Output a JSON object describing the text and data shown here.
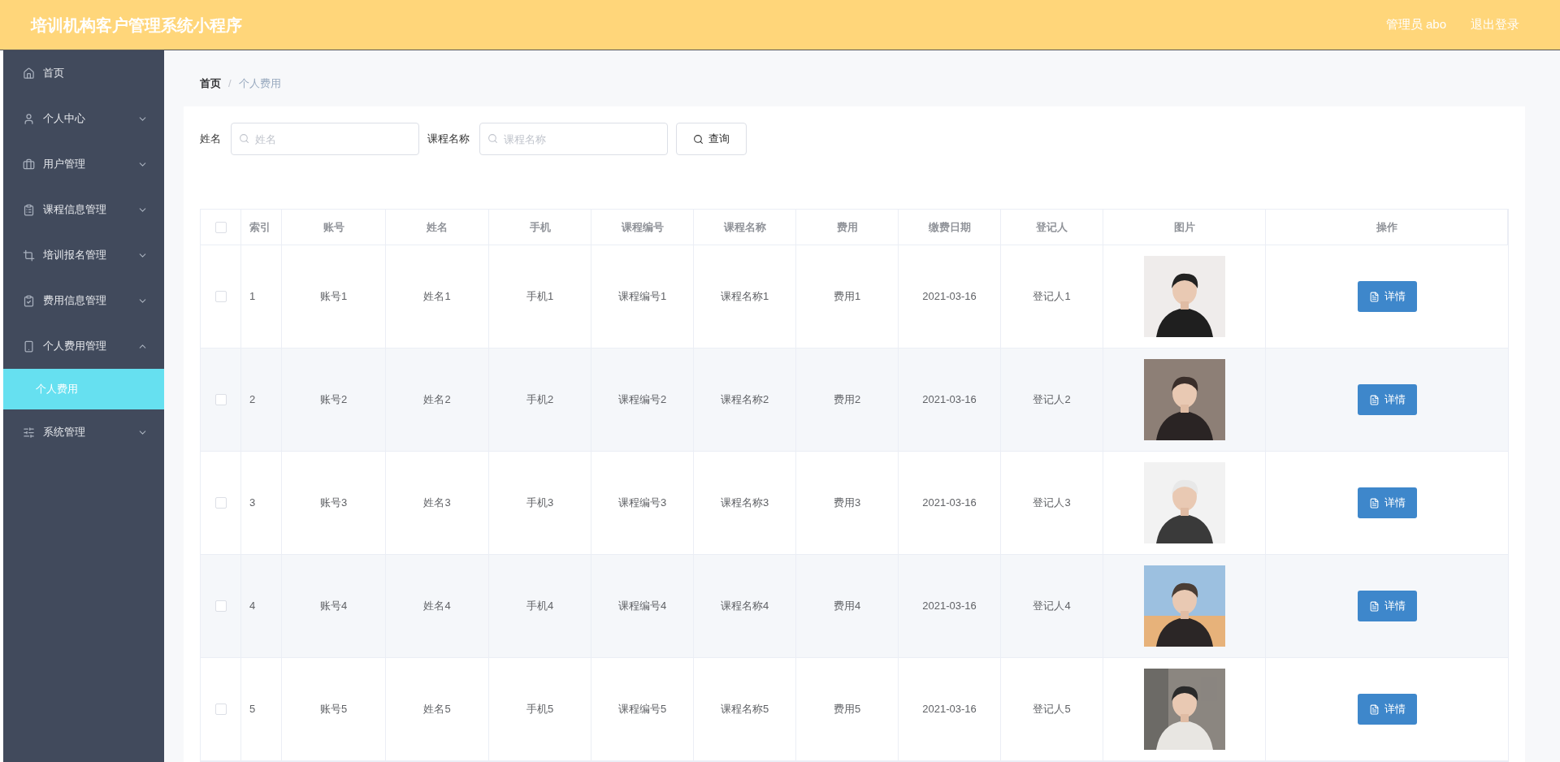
{
  "header": {
    "title": "培训机构客户管理系统小程序",
    "user": "管理员 abo",
    "logout": "退出登录"
  },
  "sidebar": {
    "items": [
      {
        "label": "首页",
        "expandable": false
      },
      {
        "label": "个人中心",
        "expandable": true,
        "expanded": false
      },
      {
        "label": "用户管理",
        "expandable": true,
        "expanded": false
      },
      {
        "label": "课程信息管理",
        "expandable": true,
        "expanded": false
      },
      {
        "label": "培训报名管理",
        "expandable": true,
        "expanded": false
      },
      {
        "label": "费用信息管理",
        "expandable": true,
        "expanded": false
      },
      {
        "label": "个人费用管理",
        "expandable": true,
        "expanded": true,
        "children": [
          {
            "label": "个人费用",
            "selected": true
          }
        ]
      },
      {
        "label": "系统管理",
        "expandable": true,
        "expanded": false
      }
    ]
  },
  "breadcrumb": {
    "separator": "/",
    "items": [
      "首页",
      "个人费用"
    ]
  },
  "search": {
    "fields": [
      {
        "label": "姓名",
        "placeholder": "姓名"
      },
      {
        "label": "课程名称",
        "placeholder": "课程名称"
      }
    ],
    "button": "查询"
  },
  "table": {
    "select_all": {
      "checked": false
    },
    "columns": [
      "索引",
      "账号",
      "姓名",
      "手机",
      "课程编号",
      "课程名称",
      "费用",
      "缴费日期",
      "登记人",
      "图片",
      "操作"
    ],
    "rows": [
      {
        "checked": false,
        "cells": [
          "1",
          "账号1",
          "姓名1",
          "手机1",
          "课程编号1",
          "课程名称1",
          "费用1",
          "2021-03-16",
          "登记人1"
        ],
        "action": "详情"
      },
      {
        "checked": false,
        "cells": [
          "2",
          "账号2",
          "姓名2",
          "手机2",
          "课程编号2",
          "课程名称2",
          "费用2",
          "2021-03-16",
          "登记人2"
        ],
        "action": "详情"
      },
      {
        "checked": false,
        "cells": [
          "3",
          "账号3",
          "姓名3",
          "手机3",
          "课程编号3",
          "课程名称3",
          "费用3",
          "2021-03-16",
          "登记人3"
        ],
        "action": "详情"
      },
      {
        "checked": false,
        "cells": [
          "4",
          "账号4",
          "姓名4",
          "手机4",
          "课程编号4",
          "课程名称4",
          "费用4",
          "2021-03-16",
          "登记人4"
        ],
        "action": "详情"
      },
      {
        "checked": false,
        "cells": [
          "5",
          "账号5",
          "姓名5",
          "手机5",
          "课程编号5",
          "课程名称5",
          "费用5",
          "2021-03-16",
          "登记人5"
        ],
        "action": "详情"
      }
    ]
  }
}
